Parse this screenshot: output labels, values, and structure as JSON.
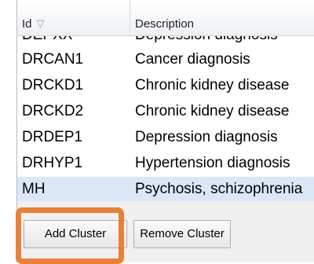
{
  "table": {
    "columns": [
      {
        "label": "Id",
        "sort_icon": "sort-descending-icon"
      },
      {
        "label": "Description"
      }
    ],
    "partial_row": {
      "id": "DEPXX",
      "description": "Depression diagnosis"
    },
    "rows": [
      {
        "id": "DRCAN1",
        "description": "Cancer diagnosis",
        "selected": false
      },
      {
        "id": "DRCKD1",
        "description": "Chronic kidney disease",
        "selected": false
      },
      {
        "id": "DRCKD2",
        "description": "Chronic kidney disease",
        "selected": false
      },
      {
        "id": "DRDEP1",
        "description": "Depression diagnosis",
        "selected": false
      },
      {
        "id": "DRHYP1",
        "description": "Hypertension diagnosis",
        "selected": false
      },
      {
        "id": "MH",
        "description": "Psychosis, schizophrenia",
        "selected": true
      }
    ]
  },
  "buttons": {
    "add_label": "Add Cluster",
    "remove_label": "Remove Cluster"
  },
  "colors": {
    "highlight": "#e8803a",
    "selected_row": "#dbe6f6"
  }
}
